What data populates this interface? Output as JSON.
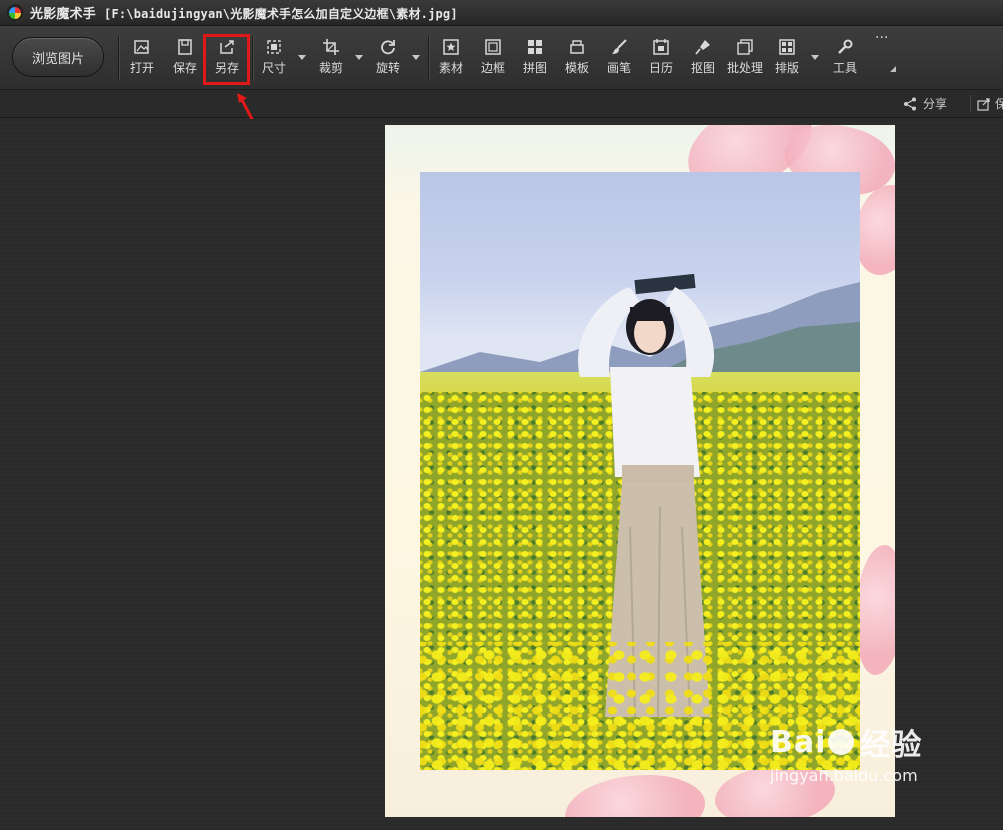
{
  "titlebar": {
    "app_name": "光影魔术手",
    "file_path": "[F:\\baidujingyan\\光影魔术手怎么加自定义边框\\素材.jpg]"
  },
  "toolbar": {
    "browse_label": "浏览图片",
    "tools": [
      {
        "label": "打开",
        "icon": "open-image-icon"
      },
      {
        "label": "保存",
        "icon": "save-icon"
      },
      {
        "label": "另存",
        "icon": "save-as-icon"
      },
      {
        "label": "尺寸",
        "icon": "resize-icon"
      },
      {
        "label": "裁剪",
        "icon": "crop-icon"
      },
      {
        "label": "旋转",
        "icon": "rotate-icon"
      },
      {
        "label": "素材",
        "icon": "material-icon"
      },
      {
        "label": "边框",
        "icon": "border-icon"
      },
      {
        "label": "拼图",
        "icon": "collage-icon"
      },
      {
        "label": "模板",
        "icon": "template-icon"
      },
      {
        "label": "画笔",
        "icon": "brush-icon"
      },
      {
        "label": "日历",
        "icon": "calendar-icon"
      },
      {
        "label": "抠图",
        "icon": "cutout-icon"
      },
      {
        "label": "批处理",
        "icon": "batch-icon"
      },
      {
        "label": "排版",
        "icon": "layout-icon"
      },
      {
        "label": "工具",
        "icon": "wrench-icon"
      },
      {
        "label": "···",
        "icon": "more-icon"
      }
    ],
    "highlighted_tool": "另存",
    "highlight_color": "#e01818"
  },
  "subbar": {
    "share_label": "分享",
    "save_label": "保"
  },
  "watermark": {
    "brand": "Bai",
    "brand_cn": "经验",
    "url": "jingyan.baidu.com"
  },
  "colors": {
    "window_bg": "#2b2b2b",
    "toolbar_bg": "#353535",
    "text": "#dcdcdc",
    "accent_red": "#e01818"
  }
}
